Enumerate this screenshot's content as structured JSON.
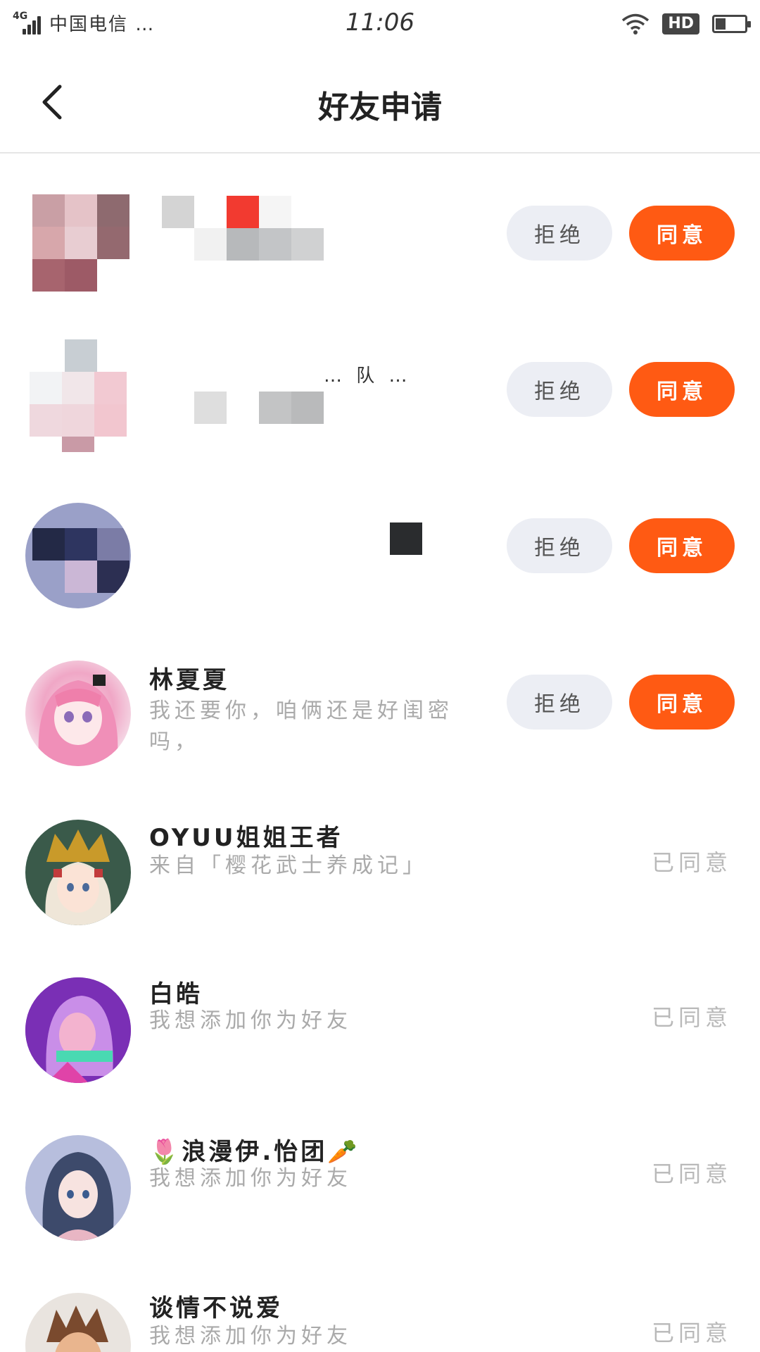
{
  "status_bar": {
    "network": "4G",
    "carrier": "中国电信 …",
    "time": "11:06",
    "hd": "HD"
  },
  "header": {
    "title": "好友申请"
  },
  "actions": {
    "reject": "拒绝",
    "accept": "同意",
    "accepted": "已同意"
  },
  "requests": [
    {
      "name": "",
      "message": "",
      "state": "pending"
    },
    {
      "name": "",
      "message": "… 队 …",
      "state": "pending"
    },
    {
      "name": "",
      "message": "",
      "state": "pending"
    },
    {
      "name": "林夏夏",
      "message": "我还要你，咱俩还是好闺密吗，",
      "state": "pending"
    },
    {
      "name": "OYUU姐姐王者",
      "message": "来自「樱花武士养成记」",
      "state": "accepted"
    },
    {
      "name": "白皓",
      "message": "我想添加你为好友",
      "state": "accepted"
    },
    {
      "name": "🌷浪漫伊.怡团🥕",
      "message": "我想添加你为好友",
      "state": "accepted"
    },
    {
      "name": "谈情不说爱",
      "message": "我想添加你为好友",
      "state": "accepted"
    }
  ],
  "colors": {
    "accent": "#ff5a13",
    "reject_bg": "#eceef4",
    "muted": "#aaaaaa"
  }
}
